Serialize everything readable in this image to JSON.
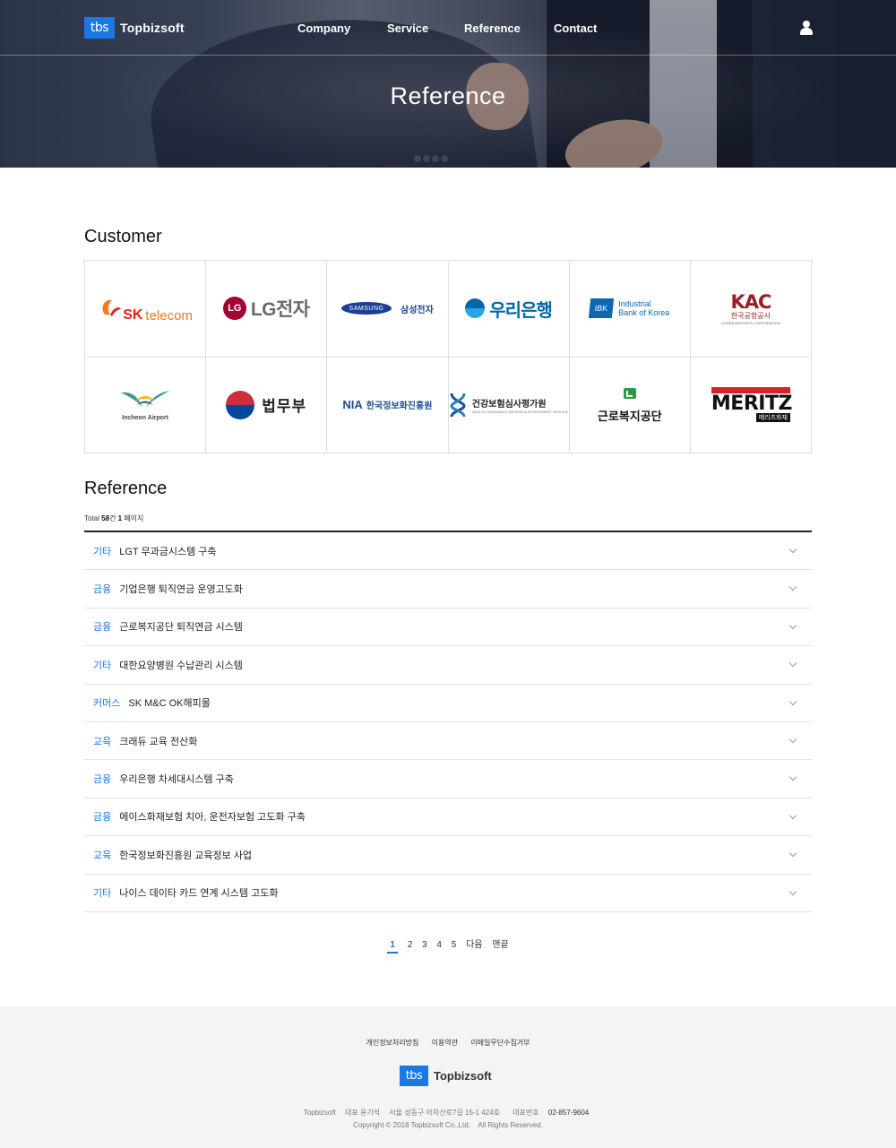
{
  "brand": {
    "logo_mark": "tbs",
    "name": "Topbizsoft",
    "accent": "#1a78e6"
  },
  "nav": {
    "items": [
      {
        "label": "Company"
      },
      {
        "label": "Service"
      },
      {
        "label": "Reference"
      },
      {
        "label": "Contact"
      }
    ],
    "user_icon": "user-icon"
  },
  "hero": {
    "title": "Reference"
  },
  "customer": {
    "title": "Customer",
    "logos": {
      "sk": {
        "brand": "SK",
        "product": "telecom"
      },
      "lg": {
        "mark": "LG",
        "text": "LG전자"
      },
      "samsung": {
        "mark": "SAMSUNG",
        "text": "삼성전자"
      },
      "woori": {
        "text": "우리은행"
      },
      "ibk": {
        "mark": "IBK",
        "line1": "Industrial",
        "line2": "Bank of Korea"
      },
      "kac": {
        "mark": "KAC",
        "ko": "한국공항공사",
        "en": "KOREA AIRPORTS CORPORATION"
      },
      "incheon": {
        "text": "Incheon Airport"
      },
      "moj": {
        "text": "법무부"
      },
      "nia": {
        "en": "NIA",
        "ko": "한국정보화진흥원"
      },
      "hira": {
        "ko": "건강보험심사평가원",
        "en": "HEALTH INSURANCE REVIEW & ASSESSMENT SERVICE"
      },
      "kcomwel": {
        "text": "근로복지공단"
      },
      "meritz": {
        "text": "MERITZ",
        "ko": "메리츠화재"
      }
    }
  },
  "reference": {
    "title": "Reference",
    "total_prefix": "Total ",
    "total_count": "58",
    "total_mid": "건 ",
    "total_page": "1",
    "total_suffix": " 페이지",
    "rows": [
      {
        "category": "기타",
        "title": "LGT 무과금시스템 구축"
      },
      {
        "category": "금융",
        "title": "기업은행 퇴직연금 운영고도화"
      },
      {
        "category": "금융",
        "title": "근로복지공단 퇴직연금 시스템"
      },
      {
        "category": "기타",
        "title": "대한요양병원 수납관리 시스템"
      },
      {
        "category": "커머스",
        "title": "SK M&C OK해피몰"
      },
      {
        "category": "교육",
        "title": "크래듀 교육 전산화"
      },
      {
        "category": "금융",
        "title": "우리은행 차세대시스템 구축"
      },
      {
        "category": "금융",
        "title": "에이스화재보험 치아, 운전자보험 고도화 구축"
      },
      {
        "category": "교육",
        "title": "한국정보화진흥원 교육정보 사업"
      },
      {
        "category": "기타",
        "title": "나이스 데이타 카드 연계 시스템 고도화"
      }
    ]
  },
  "pagination": {
    "pages": [
      "1",
      "2",
      "3",
      "4",
      "5"
    ],
    "current": "1",
    "next": "다음",
    "last": "맨끝"
  },
  "footer": {
    "links": [
      "개인정보처리방침",
      "이용약관",
      "이메일무단수집거부"
    ],
    "company": "Topbizsoft",
    "ceo": "대표 윤기석",
    "address": "서울 성동구 아차산로7길 15-1 424호",
    "phone_label": "대표번호",
    "phone": "02-857-9604",
    "copyright": "Copyright © 2018 Topbizsoft Co.,Ltd.    All Rights Reserved."
  }
}
